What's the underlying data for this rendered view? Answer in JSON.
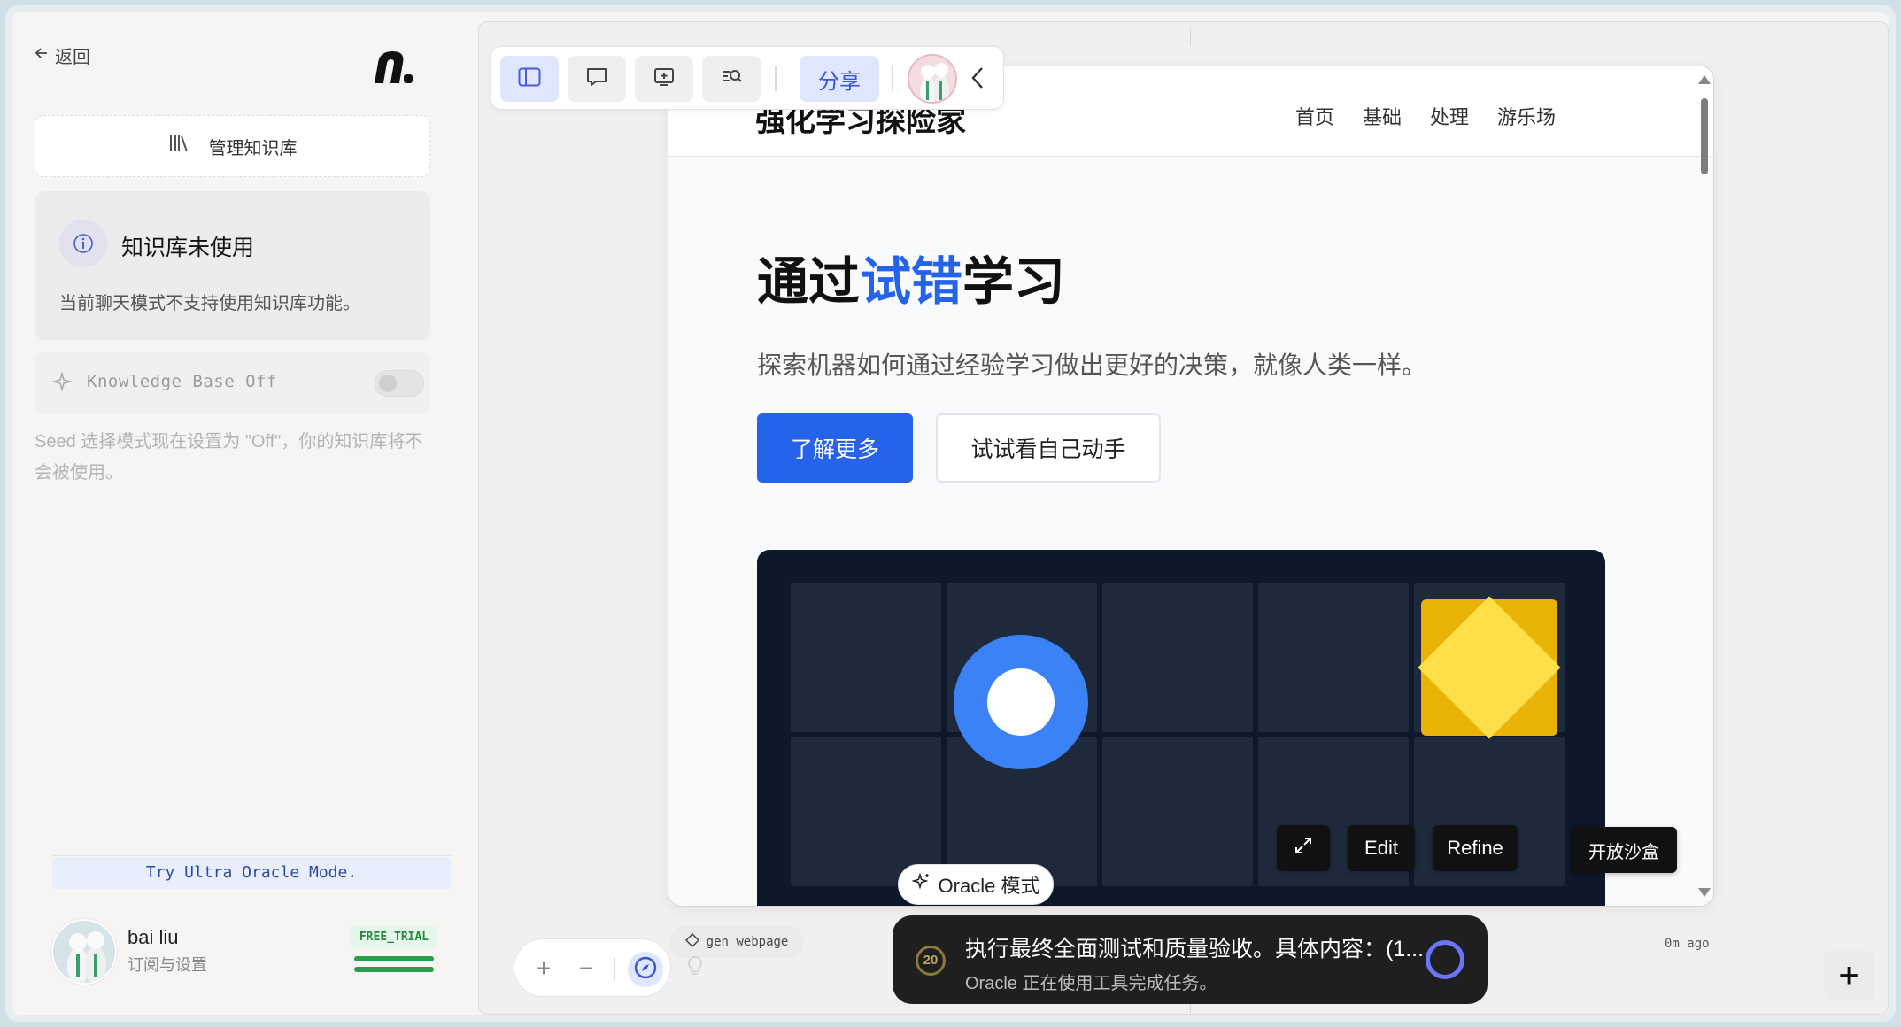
{
  "sidebar": {
    "back_label": "返回",
    "manage_kb_label": "管理知识库",
    "kb_status": {
      "title": "知识库未使用",
      "description": "当前聊天模式不支持使用知识库功能。"
    },
    "kb_toggle": {
      "label": "Knowledge Base Off",
      "enabled": false
    },
    "seed_note": "Seed 选择模式现在设置为 \"Off\"，你的知识库将不会被使用。",
    "ultra_label": "Try Ultra Oracle Mode.",
    "user": {
      "name": "bai liu",
      "subtitle": "订阅与设置",
      "plan_badge": "FREE_TRIAL"
    }
  },
  "toolbar": {
    "share_label": "分享",
    "icons": [
      "sidebar-panel-icon",
      "chat-icon",
      "add-screen-icon",
      "search-doc-icon",
      "chevron-left-icon"
    ]
  },
  "preview": {
    "brand": "强化学习探险家",
    "nav": [
      "首页",
      "基础",
      "处理",
      "游乐场"
    ],
    "hero": {
      "title_before": "通过",
      "title_accent": "试错",
      "title_after": "学习",
      "subtitle": "探索机器如何通过经验学习做出更好的决策，就像人类一样。",
      "primary_button": "了解更多",
      "secondary_button": "试试看自己动手"
    },
    "accent_color": "#2563eb"
  },
  "overlay": {
    "edit_label": "Edit",
    "refine_label": "Refine",
    "sandbox_label": "开放沙盒"
  },
  "oracle_mode_label": "Oracle 模式",
  "task": {
    "step": "20",
    "title": "执行最终全面测试和质量验收。具体内容：(1...",
    "subtitle": "Oracle 正在使用工具完成任务。"
  },
  "node_chip_label": "gen webpage",
  "timestamp": "0m ago",
  "zoom": {
    "plus": "+",
    "minus": "−"
  },
  "fab_label": "+"
}
